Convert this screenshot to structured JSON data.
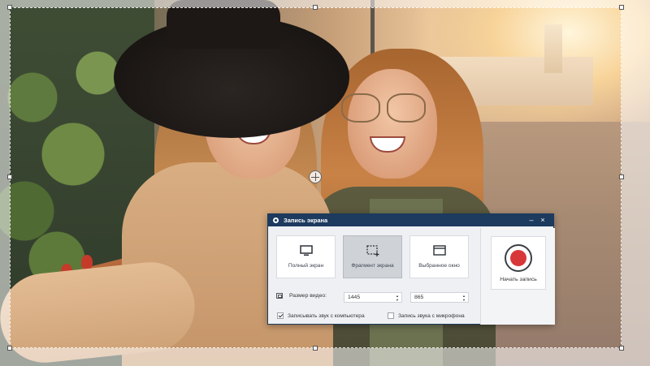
{
  "dialog": {
    "title": "Запись экрана",
    "controls": {
      "minimize": "–",
      "close": "×"
    },
    "modes": [
      {
        "label": "Полный экран",
        "icon": "monitor-icon",
        "active": false
      },
      {
        "label": "Фрагмент экрана",
        "icon": "region-select-icon",
        "active": true
      },
      {
        "label": "Выбранное окно",
        "icon": "window-icon",
        "active": false
      }
    ],
    "start_button": {
      "label": "Начать запись",
      "icon": "record-icon",
      "color": "#d8373a"
    },
    "video_size": {
      "label": "Размер видео:",
      "width": "1445",
      "height": "865"
    },
    "options": [
      {
        "label": "Записывать звук с компьютера",
        "checked": true
      },
      {
        "label": "Запись звука с микрофона",
        "checked": false
      }
    ]
  },
  "colors": {
    "titlebar": "#1d3a5f",
    "record": "#d8373a",
    "active_mode": "#cfd3d8"
  }
}
